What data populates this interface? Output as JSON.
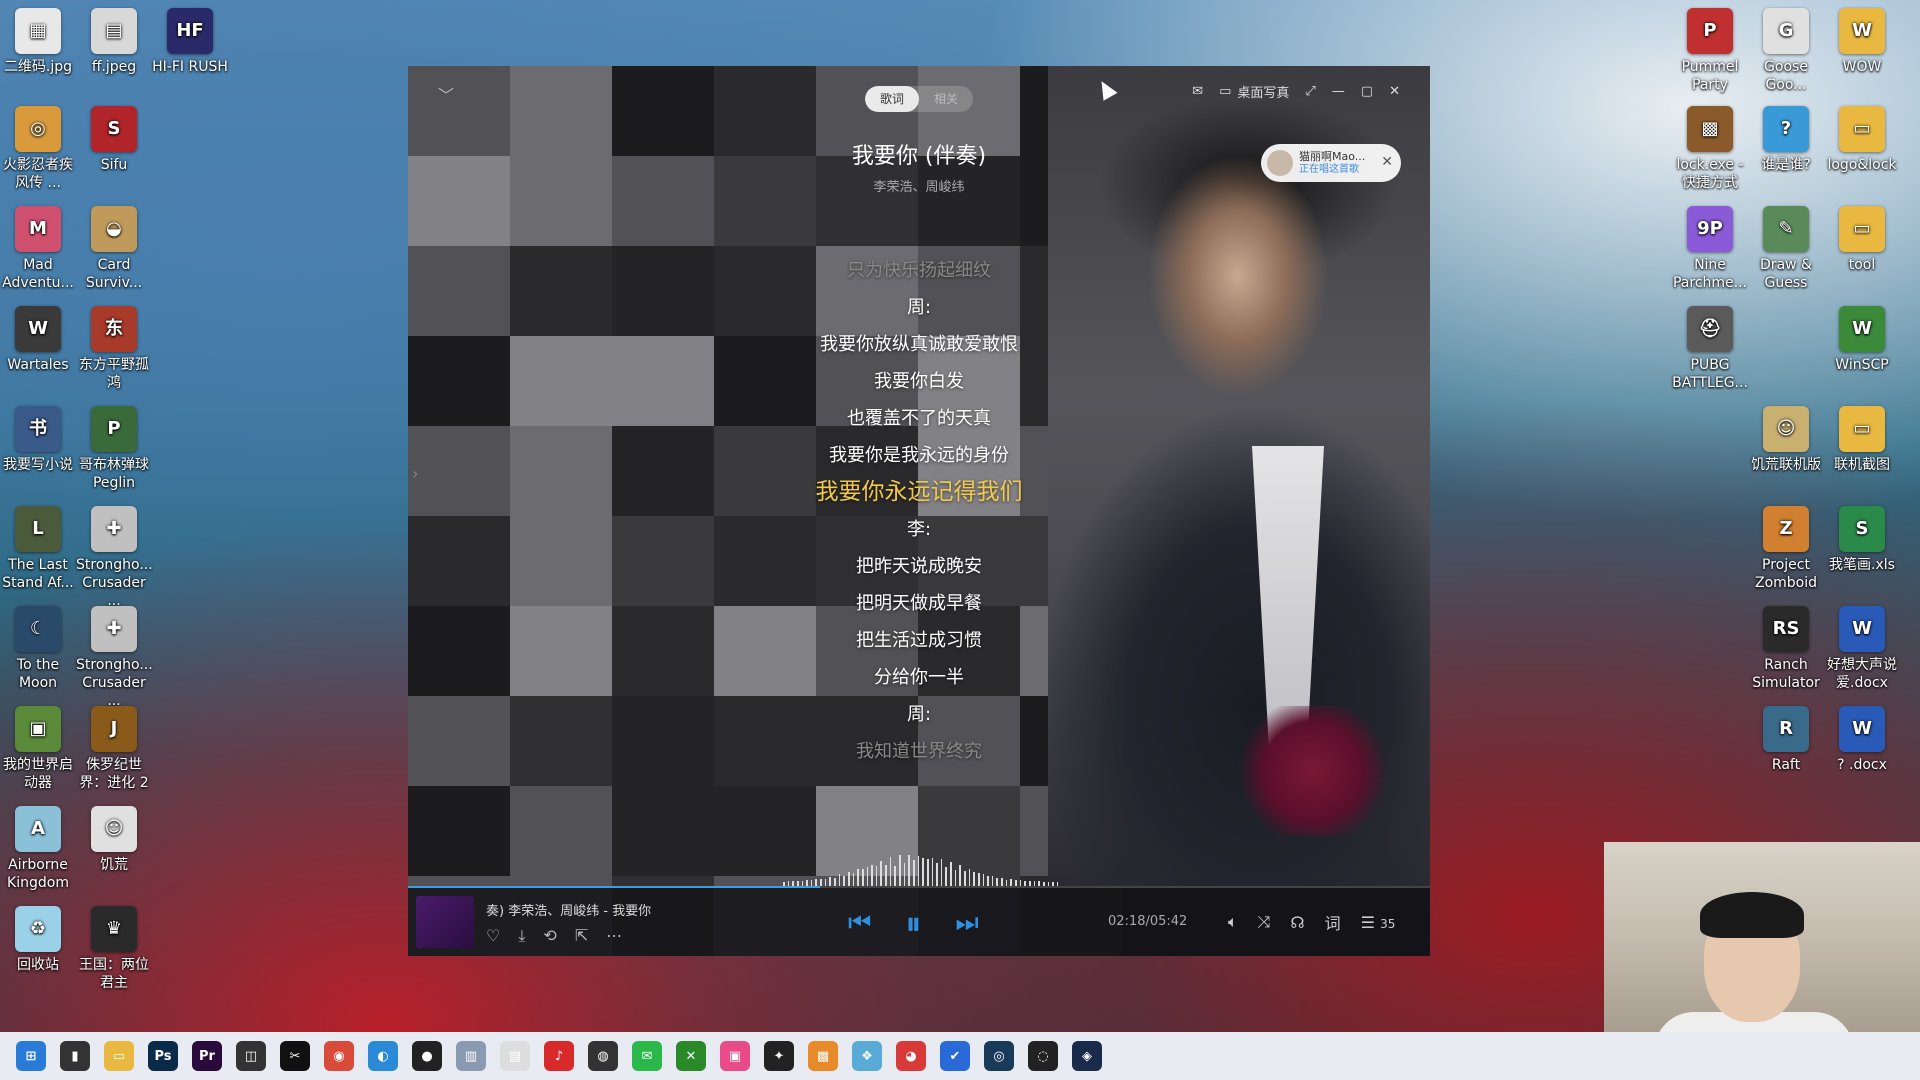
{
  "desktop": {
    "left_icons": [
      {
        "label": "二维码.jpg",
        "color": "#e8e8e8",
        "glyph": "▦"
      },
      {
        "label": "ff.jpeg",
        "color": "#d8d8d8",
        "glyph": "▤"
      },
      {
        "label": "HI-FI RUSH",
        "color": "#2a2a6a",
        "glyph": "HF"
      },
      {
        "label": "火影忍者疾风传 ...",
        "color": "#d89a3a",
        "glyph": "◎"
      },
      {
        "label": "Sifu",
        "color": "#b0242a",
        "glyph": "S"
      },
      {
        "label": "Mad Adventu...",
        "color": "#d05070",
        "glyph": "M"
      },
      {
        "label": "Card Surviv...",
        "color": "#c09a5a",
        "glyph": "◒"
      },
      {
        "label": "Wartales",
        "color": "#3a3a3a",
        "glyph": "W"
      },
      {
        "label": "东方平野孤鸿",
        "color": "#a83a2a",
        "glyph": "东"
      },
      {
        "label": "我要写小说",
        "color": "#3a5a8a",
        "glyph": "书"
      },
      {
        "label": "哥布林弹球 Peglin",
        "color": "#3a6a3a",
        "glyph": "P"
      },
      {
        "label": "The Last Stand Af...",
        "color": "#4a5a3a",
        "glyph": "L"
      },
      {
        "label": "Strongho... Crusader ...",
        "color": "#c0c0c0",
        "glyph": "✚"
      },
      {
        "label": "To the Moon",
        "color": "#2a4a6a",
        "glyph": "☾"
      },
      {
        "label": "Strongho... Crusader ...",
        "color": "#c0c0c0",
        "glyph": "✚"
      },
      {
        "label": "我的世界启动器",
        "color": "#5a8a3a",
        "glyph": "▣"
      },
      {
        "label": "侏罗纪世界：进化 2",
        "color": "#8a5a1a",
        "glyph": "J"
      },
      {
        "label": "Airborne Kingdom",
        "color": "#8ac0d8",
        "glyph": "A"
      },
      {
        "label": "饥荒",
        "color": "#e0e0e0",
        "glyph": "☺"
      },
      {
        "label": "回收站",
        "color": "#9ad0e8",
        "glyph": "♻"
      },
      {
        "label": "王国：两位君主",
        "color": "#2a2a2a",
        "glyph": "♛"
      }
    ],
    "right_icons": [
      {
        "label": "Pummel Party",
        "color": "#c03030",
        "glyph": "P"
      },
      {
        "label": "Goose Goo...",
        "color": "#e0e0e0",
        "glyph": "G"
      },
      {
        "label": "WOW",
        "color": "#e8b840",
        "glyph": "W"
      },
      {
        "label": "lock.exe - 快捷方式",
        "color": "#8a5a2a",
        "glyph": "▩"
      },
      {
        "label": "谁是谁?",
        "color": "#3a9ad8",
        "glyph": "?"
      },
      {
        "label": "logo&lock",
        "color": "#e8b840",
        "glyph": "▭"
      },
      {
        "label": "Nine Parchme...",
        "color": "#8a5ad8",
        "glyph": "9P"
      },
      {
        "label": "Draw & Guess",
        "color": "#5a8a5a",
        "glyph": "✎"
      },
      {
        "label": "tool",
        "color": "#e8b840",
        "glyph": "▭"
      },
      {
        "label": "PUBG BATTLEG...",
        "color": "#5a5a5a",
        "glyph": "⛑"
      },
      {
        "label": "WinSCP",
        "color": "#3a8a3a",
        "glyph": "W"
      },
      {
        "label": "饥荒联机版",
        "color": "#c8b070",
        "glyph": "☺"
      },
      {
        "label": "联机截图",
        "color": "#e8b840",
        "glyph": "▭"
      },
      {
        "label": "Project Zomboid",
        "color": "#d08030",
        "glyph": "Z"
      },
      {
        "label": "我笔画.xls",
        "color": "#2a8a4a",
        "glyph": "S"
      },
      {
        "label": "Ranch Simulator",
        "color": "#2a2a2a",
        "glyph": "RS"
      },
      {
        "label": "好想大声说爱.docx",
        "color": "#2a5ab8",
        "glyph": "W"
      },
      {
        "label": "Raft",
        "color": "#3a6a8a",
        "glyph": "R"
      },
      {
        "label": "? .docx",
        "color": "#2a5ab8",
        "glyph": "W"
      }
    ]
  },
  "player": {
    "tabs": [
      "歌词",
      "相关"
    ],
    "active_tab": "歌词",
    "desk_lyrics_label": "桌面写真",
    "song_title": "我要你 (伴奏)",
    "song_artist": "李荣浩、周峻纬",
    "notification": {
      "name": "猫丽啊Mao...",
      "status": "正在唱这首歌"
    },
    "lyrics": [
      {
        "text": "只为快乐扬起细纹",
        "state": "dim"
      },
      {
        "text": "周:",
        "state": "normal"
      },
      {
        "text": "我要你放纵真诚敢爱敢恨",
        "state": "normal"
      },
      {
        "text": "我要你白发",
        "state": "normal"
      },
      {
        "text": "也覆盖不了的天真",
        "state": "normal"
      },
      {
        "text": "我要你是我永远的身份",
        "state": "normal"
      },
      {
        "text": "我要你永远记得我们",
        "state": "active"
      },
      {
        "text": "李:",
        "state": "normal"
      },
      {
        "text": "把昨天说成晚安",
        "state": "normal"
      },
      {
        "text": "把明天做成早餐",
        "state": "normal"
      },
      {
        "text": "把生活过成习惯",
        "state": "normal"
      },
      {
        "text": "分给你一半",
        "state": "normal"
      },
      {
        "text": "周:",
        "state": "normal"
      },
      {
        "text": "我知道世界终究",
        "state": "dim"
      }
    ],
    "now_playing": "奏)    李荣浩、周峻纬 - 我要你",
    "time": "02:18/05:42",
    "progress_fraction": 0.403,
    "playlist_count": "35",
    "accent_color": "#2f8fe0",
    "lyric_highlight_color": "#f2c94c"
  },
  "taskbar": {
    "apps": [
      {
        "name": "start",
        "glyph": "⊞",
        "color": "#2a7ad8"
      },
      {
        "name": "terminal",
        "glyph": "▮",
        "color": "#333"
      },
      {
        "name": "explorer",
        "glyph": "▭",
        "color": "#e8b840"
      },
      {
        "name": "photoshop",
        "glyph": "Ps",
        "color": "#0a2a4a"
      },
      {
        "name": "premiere",
        "glyph": "Pr",
        "color": "#2a0a3a"
      },
      {
        "name": "app",
        "glyph": "◫",
        "color": "#333"
      },
      {
        "name": "capcut",
        "glyph": "✂",
        "color": "#111"
      },
      {
        "name": "chrome",
        "glyph": "◉",
        "color": "#d84a3a"
      },
      {
        "name": "edge",
        "glyph": "◐",
        "color": "#2a8ad8"
      },
      {
        "name": "record",
        "glyph": "●",
        "color": "#222"
      },
      {
        "name": "app2",
        "glyph": "▥",
        "color": "#8a9ab0"
      },
      {
        "name": "notepad",
        "glyph": "▤",
        "color": "#ddd"
      },
      {
        "name": "netease",
        "glyph": "♪",
        "color": "#d82a2a"
      },
      {
        "name": "app3",
        "glyph": "◍",
        "color": "#333"
      },
      {
        "name": "wechat",
        "glyph": "✉",
        "color": "#2ab84a"
      },
      {
        "name": "xbox",
        "glyph": "✕",
        "color": "#2a8a2a"
      },
      {
        "name": "app4",
        "glyph": "▣",
        "color": "#e84a8a"
      },
      {
        "name": "app5",
        "glyph": "✦",
        "color": "#222"
      },
      {
        "name": "app6",
        "glyph": "▩",
        "color": "#e88a2a"
      },
      {
        "name": "app7",
        "glyph": "❖",
        "color": "#5aaad8"
      },
      {
        "name": "app8",
        "glyph": "◕",
        "color": "#d83a3a"
      },
      {
        "name": "app9",
        "glyph": "✔",
        "color": "#2a6ad8"
      },
      {
        "name": "app10",
        "glyph": "◎",
        "color": "#1a3a5a"
      },
      {
        "name": "app11",
        "glyph": "◌",
        "color": "#222"
      },
      {
        "name": "steam",
        "glyph": "◈",
        "color": "#1a2a4a"
      }
    ]
  }
}
